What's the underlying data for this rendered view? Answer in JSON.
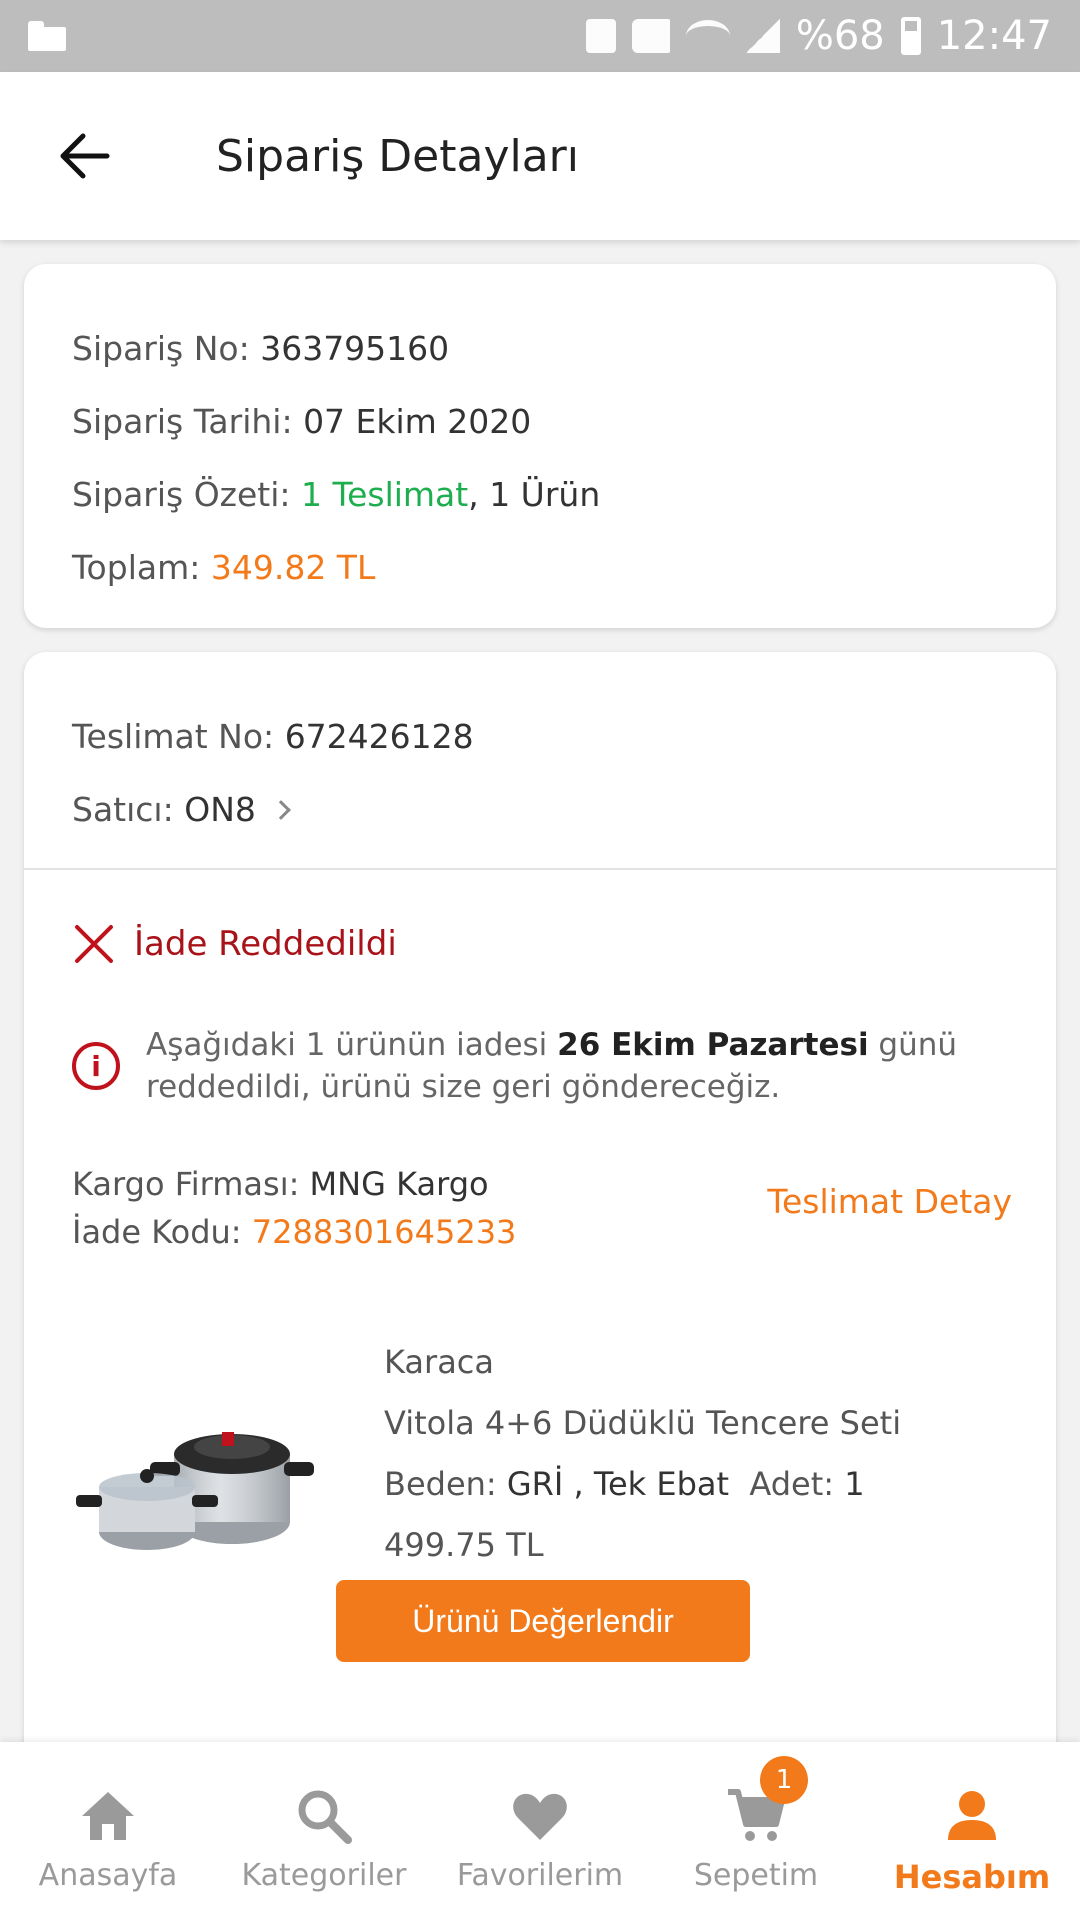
{
  "status_bar": {
    "battery": "%68",
    "time": "12:47"
  },
  "header": {
    "title": "Sipariş Detayları"
  },
  "order": {
    "no_label": "Sipariş No:",
    "no_value": "363795160",
    "date_label": "Sipariş Tarihi:",
    "date_value": "07 Ekim 2020",
    "summary_label": "Sipariş Özeti:",
    "summary_deliveries": "1 Teslimat",
    "summary_items": ", 1 Ürün",
    "total_label": "Toplam:",
    "total_value": "349.82 TL"
  },
  "delivery": {
    "no_label": "Teslimat No:",
    "no_value": "672426128",
    "seller_label": "Satıcı:",
    "seller_value": "ON8",
    "status": "İade Reddedildi",
    "info_pre": "Aşağıdaki 1 ürünün iadesi ",
    "info_bold": "26 Ekim Pazartesi",
    "info_post": " günü reddedildi, ürünü size geri göndereceğiz.",
    "cargo_label": "Kargo Firması:",
    "cargo_value": "MNG Kargo",
    "return_code_label": "İade Kodu:",
    "return_code_value": "7288301645233",
    "detail_link": "Teslimat Detay"
  },
  "product": {
    "brand": "Karaca",
    "name": "Vitola 4+6 Düdüklü Tencere Seti",
    "variant_label": "Beden:",
    "variant_value": "GRİ , Tek Ebat",
    "qty_label": "Adet:",
    "qty_value": "1",
    "price": "499.75 TL",
    "review_button": "Ürünü Değerlendir"
  },
  "nav": {
    "items": [
      {
        "label": "Anasayfa",
        "icon": "home-icon"
      },
      {
        "label": "Kategoriler",
        "icon": "search-icon"
      },
      {
        "label": "Favorilerim",
        "icon": "heart-icon"
      },
      {
        "label": "Sepetim",
        "icon": "cart-icon",
        "badge": "1"
      },
      {
        "label": "Hesabım",
        "icon": "person-icon",
        "active": true
      }
    ]
  },
  "colors": {
    "accent": "#f27a1a",
    "success": "#1fae4f",
    "error": "#c0121c"
  }
}
